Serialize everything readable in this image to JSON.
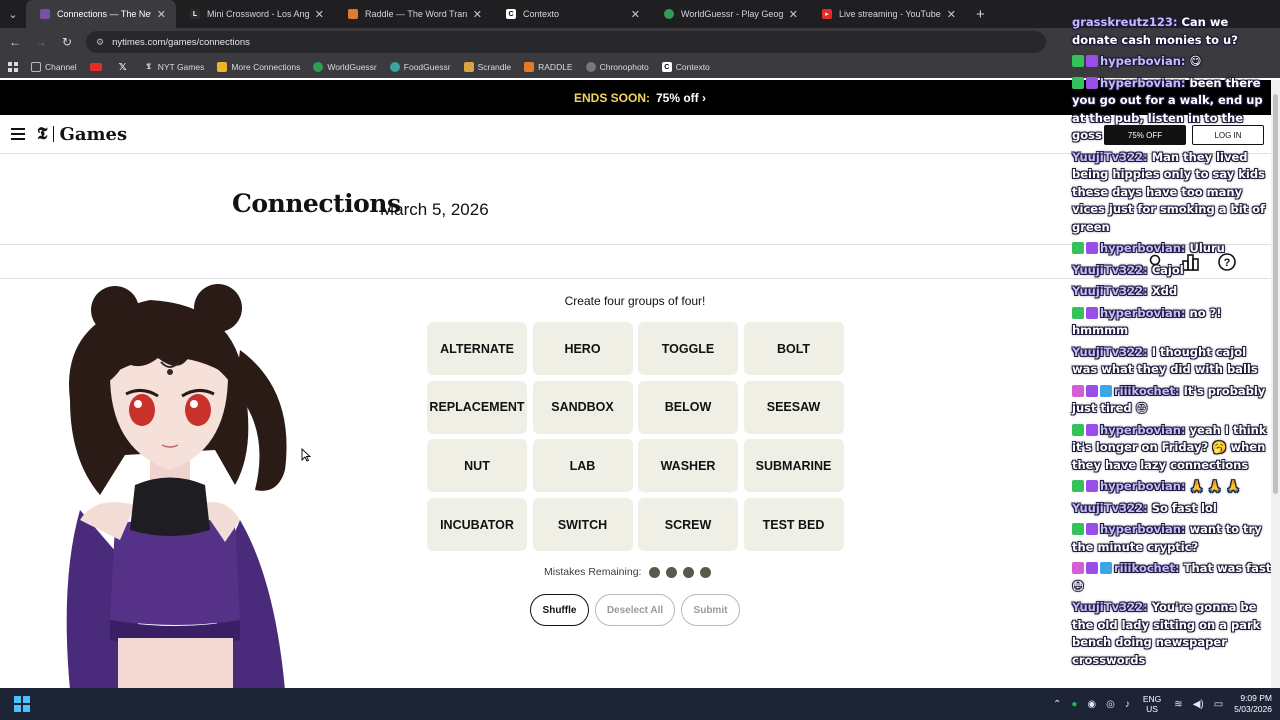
{
  "browser": {
    "tabs": [
      {
        "title": "Connections — The New York Times",
        "active": true,
        "favicon_color": "#7b4fa6",
        "icon": "nyt-games-icon"
      },
      {
        "title": "Mini Crossword - Los Angeles Times",
        "active": false,
        "favicon_color": "#2b2b2b",
        "icon": "la-times-icon"
      },
      {
        "title": "Raddle — The Word Transformation",
        "active": false,
        "favicon_color": "#e27a2b",
        "icon": "raddle-icon"
      },
      {
        "title": "Contexto",
        "active": false,
        "favicon_color": "#ffffff",
        "icon": "contexto-icon"
      },
      {
        "title": "WorldGuessr - Play Geoguessr Free",
        "active": false,
        "favicon_color": "#2f9e55",
        "icon": "worldguessr-icon"
      },
      {
        "title": "Live streaming - YouTube Studio",
        "active": false,
        "favicon_color": "#e52d27",
        "icon": "youtube-icon"
      }
    ],
    "new_tab": "+",
    "url": "nytimes.com/games/connections",
    "bookmarks": [
      {
        "label": "Channel",
        "icon": "folder-icon",
        "color": "#9aa0a6"
      },
      {
        "label": "",
        "icon": "youtube-icon",
        "color": "#e52d27"
      },
      {
        "label": "",
        "icon": "x-icon",
        "color": "#000000"
      },
      {
        "label": "NYT Games",
        "icon": "nyt-icon",
        "color": "#333333"
      },
      {
        "label": "More Connections",
        "icon": "grid-icon",
        "color": "#f0b429"
      },
      {
        "label": "WorldGuessr",
        "icon": "globe-icon",
        "color": "#2f9e55"
      },
      {
        "label": "FoodGuessr",
        "icon": "globe-icon",
        "color": "#3aa6a0"
      },
      {
        "label": "Scrandle",
        "icon": "scrandle-icon",
        "color": "#d9a441"
      },
      {
        "label": "RADDLE",
        "icon": "raddle-icon",
        "color": "#e27a2b"
      },
      {
        "label": "Chronophoto",
        "icon": "camera-icon",
        "color": "#888888"
      },
      {
        "label": "Contexto",
        "icon": "contexto-icon",
        "color": "#ffffff"
      }
    ]
  },
  "promo": {
    "ends": "ENDS SOON:",
    "offer": "75% off ›"
  },
  "header": {
    "logo_t": "𝕿",
    "logo_text": "Games",
    "btn_primary": "75% OFF",
    "btn_secondary": "LOG IN"
  },
  "game": {
    "title": "Connections",
    "date": "March 5, 2026",
    "subtitle": "Create four groups of four!",
    "tiles": [
      "ALTERNATE",
      "HERO",
      "TOGGLE",
      "BOLT",
      "REPLACEMENT",
      "SANDBOX",
      "BELOW",
      "SEESAW",
      "NUT",
      "LAB",
      "WASHER",
      "SUBMARINE",
      "INCUBATOR",
      "SWITCH",
      "SCREW",
      "TEST BED"
    ],
    "mistakes_label": "Mistakes Remaining:",
    "mistakes_remaining": 4,
    "buttons": {
      "shuffle": "Shuffle",
      "deselect": "Deselect All",
      "submit": "Submit"
    }
  },
  "chat": [
    {
      "user": "grasskreutz123:",
      "badges": [],
      "text": "Can we donate cash monies to u?"
    },
    {
      "user": "hyperbovian:",
      "badges": [
        "green",
        "purple"
      ],
      "text": "😋"
    },
    {
      "user": "hyperbovian:",
      "badges": [
        "green",
        "purple"
      ],
      "text": "been there you go out for a walk, end up at the pub, listen in to the goss"
    },
    {
      "user": "YuujiTv322:",
      "badges": [],
      "text": "Man they lived being hippies only to say kids these days have too many vices just for smoking a bit of green"
    },
    {
      "user": "hyperbovian:",
      "badges": [
        "green",
        "purple"
      ],
      "text": "Uluru"
    },
    {
      "user": "YuujiTv322:",
      "badges": [],
      "text": "Cajol"
    },
    {
      "user": "YuujiTv322:",
      "badges": [],
      "text": "Xdd"
    },
    {
      "user": "hyperbovian:",
      "badges": [
        "green",
        "purple"
      ],
      "text": "no ?! hmmmm"
    },
    {
      "user": "YuujiTv322:",
      "badges": [],
      "text": "I thought cajol was what they did with balls"
    },
    {
      "user": "riiikochet:",
      "badges": [
        "pink",
        "purple",
        "blue"
      ],
      "text": "It's probably just tired 😄"
    },
    {
      "user": "hyperbovian:",
      "badges": [
        "green",
        "purple"
      ],
      "text": "yeah I think it's longer on Friday? 🥱 when they have lazy connections"
    },
    {
      "user": "hyperbovian:",
      "badges": [
        "green",
        "purple"
      ],
      "text": "🙏 🙏 🙏"
    },
    {
      "user": "YuujiTv322:",
      "badges": [],
      "text": "So fast lol"
    },
    {
      "user": "hyperbovian:",
      "badges": [
        "green",
        "purple"
      ],
      "text": "want to try the minute cryptic?"
    },
    {
      "user": "riiikochet:",
      "badges": [
        "pink",
        "purple",
        "blue"
      ],
      "text": "That was fast 😳"
    },
    {
      "user": "YuujiTv322:",
      "badges": [],
      "text": "You're gonna be the old lady sitting on a park bench doing newspaper crosswords"
    }
  ],
  "taskbar": {
    "lang_top": "ENG",
    "lang_bottom": "US",
    "time": "9:09 PM",
    "date": "5/03/2026"
  },
  "colors": {
    "tile_bg": "#efefe6",
    "promo_yellow": "#f6d45a",
    "dot": "#5a594e",
    "chat_name": "#c9b8ff"
  }
}
